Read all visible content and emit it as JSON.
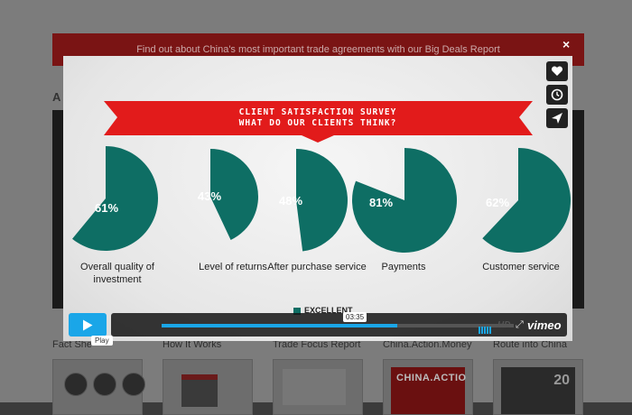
{
  "page": {
    "banner_text": "Find out about China's most important trade agreements with our Big Deals Report",
    "partial_letter": "A",
    "thumb_labels": [
      "Fact She",
      "How It Works",
      "Trade Focus Report",
      "China.Action.Money",
      "Route into China"
    ],
    "thumb_red_text": "CHINA.ACTIO",
    "thumb_dark_text": "20"
  },
  "modal": {
    "close_label": "×",
    "ribbon_line1": "CLIENT SATISFACTION SURVEY",
    "ribbon_line2": "WHAT DO OUR CLIENTS THINK?",
    "legend": "EXCELLENT",
    "icons": [
      "heart-icon",
      "clock-icon",
      "send-icon"
    ]
  },
  "chart_data": {
    "type": "pie",
    "title": "CLIENT SATISFACTION SURVEY",
    "subtitle": "WHAT DO OUR CLIENTS THINK?",
    "legend": [
      "EXCELLENT"
    ],
    "categories": [
      "Overall quality of investment",
      "Level of returns",
      "After purchase service",
      "Payments",
      "Customer service"
    ],
    "values": [
      61,
      43,
      48,
      81,
      62
    ],
    "value_labels": [
      "61%",
      "43%",
      "48%",
      "81%",
      "62%"
    ],
    "color": "#0e6e64"
  },
  "player": {
    "time_tooltip": "03:35",
    "progress": 0.67,
    "hd_label": "HD",
    "brand": "vimeo",
    "play_tooltip": "Play",
    "accent": "#1aa6e8"
  }
}
